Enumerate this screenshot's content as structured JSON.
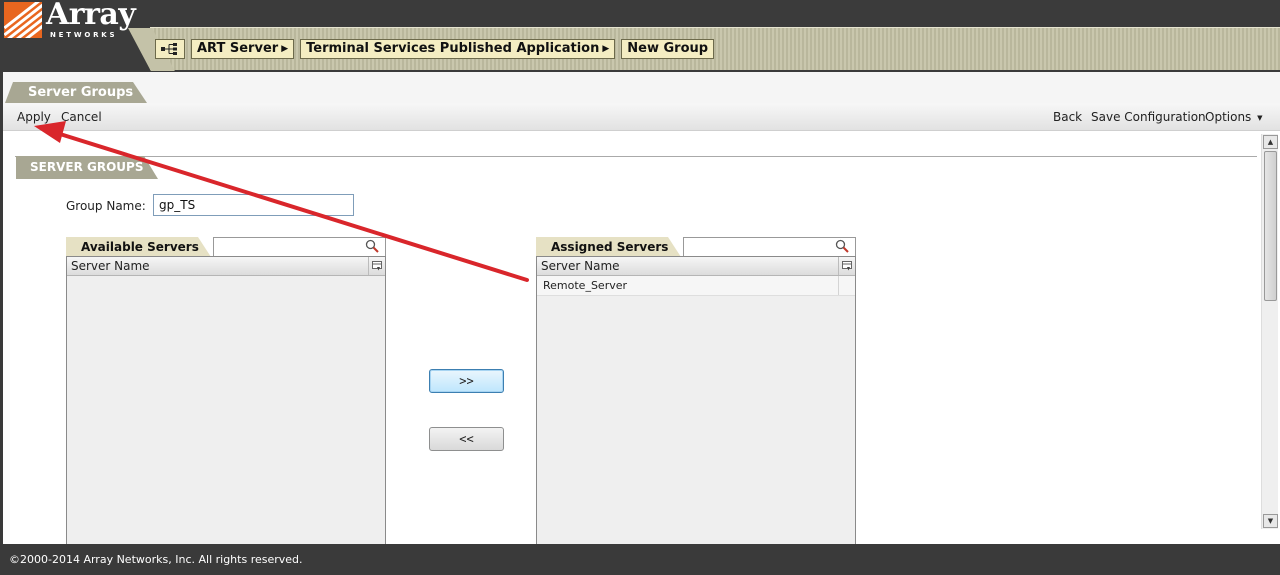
{
  "brand": {
    "name": "Array",
    "subtitle": "NETWORKS",
    "accent_color": "#e8661f"
  },
  "breadcrumb": {
    "home_icon": "network-tree-icon",
    "items": [
      "ART Server",
      "Terminal Services Published Application",
      "New Group"
    ]
  },
  "page_tab": "Server Groups",
  "toolbar": {
    "apply": "Apply",
    "cancel": "Cancel",
    "back": "Back",
    "save_config": "Save Configuration",
    "options": "Options"
  },
  "section": {
    "title": "SERVER GROUPS",
    "group_name_label": "Group Name:",
    "group_name_value": "gp_TS"
  },
  "available": {
    "tab": "Available Servers",
    "search_placeholder": "",
    "column": "Server Name",
    "rows": []
  },
  "assigned": {
    "tab": "Assigned Servers",
    "search_placeholder": "",
    "column": "Server Name",
    "rows": [
      "Remote_Server"
    ]
  },
  "buttons": {
    "add": ">>",
    "remove": "<<"
  },
  "footer": "©2000-2014 Array Networks, Inc. All rights reserved.",
  "annotation_color": "#d9262b"
}
